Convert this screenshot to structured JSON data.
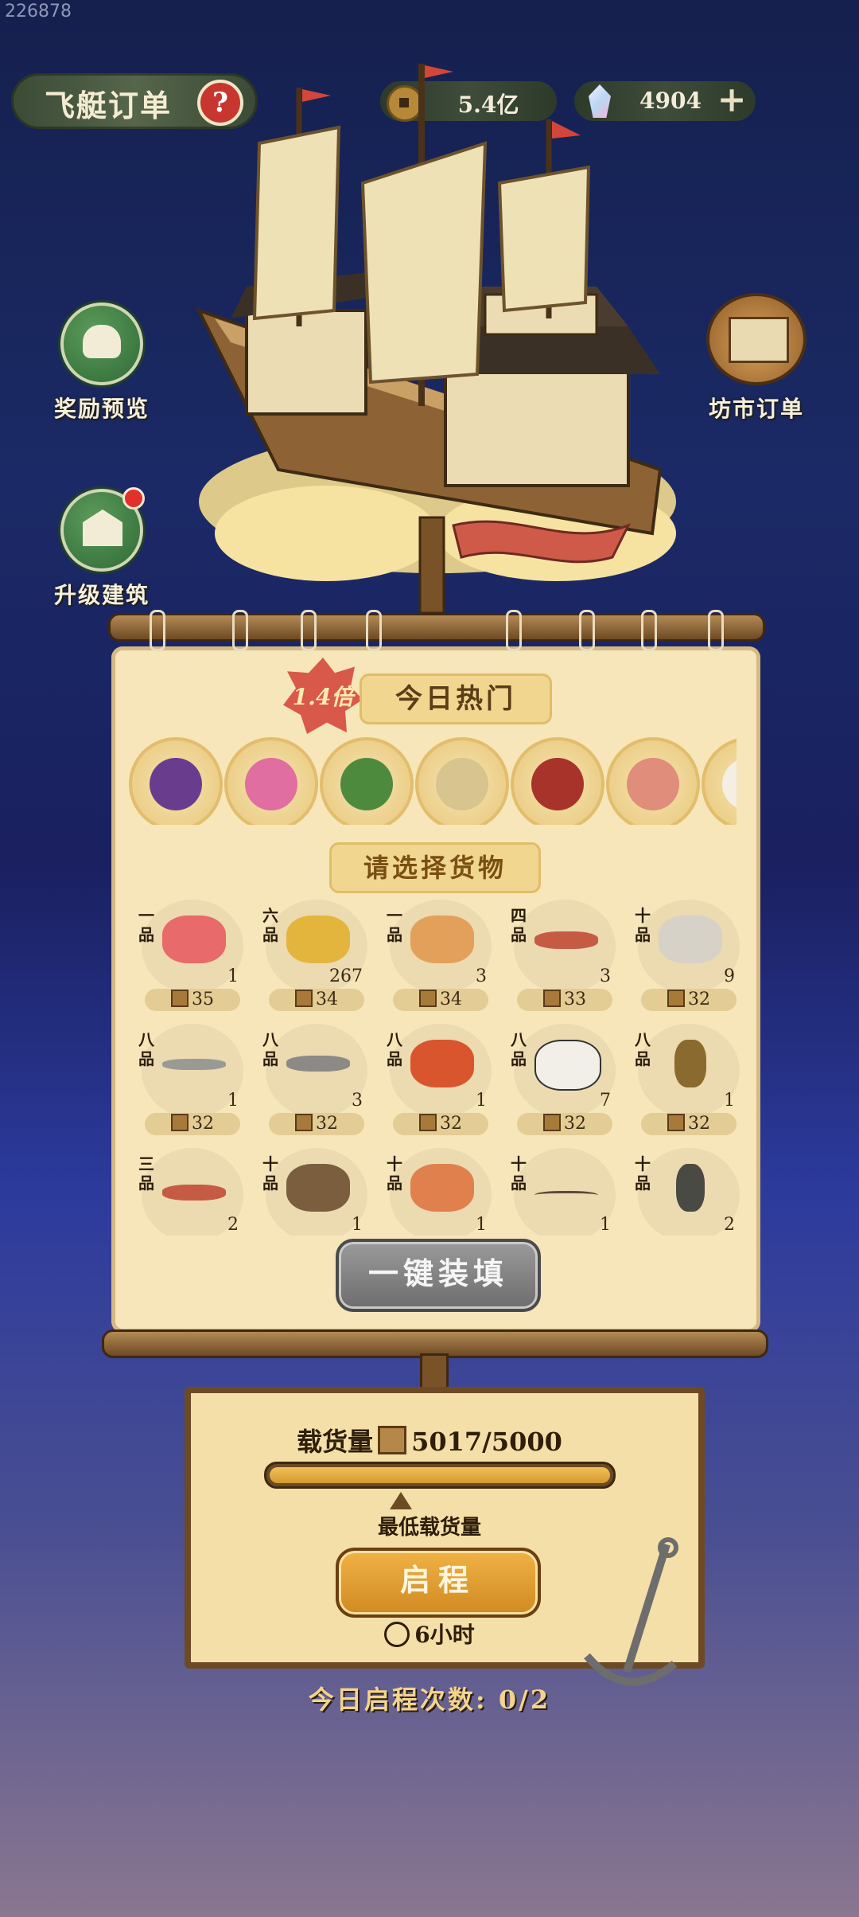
{
  "id_tag": "226878",
  "header": {
    "title": "飞艇订单",
    "help_glyph": "?"
  },
  "resources": {
    "coins": "5.4亿",
    "gems": "4904",
    "plus": "+"
  },
  "side": {
    "rewards_label": "奖励预览",
    "upgrade_label": "升级建筑",
    "market_label": "坊市订单"
  },
  "hot": {
    "multiplier": "1.4倍",
    "title": "今日热门",
    "items": [
      "eggplant-icon",
      "flower-icon",
      "watermelon-icon",
      "zongzi-icon",
      "spicy-dish-icon",
      "salmon-icon",
      "egg-icon"
    ]
  },
  "goods": {
    "title": "请选择货物",
    "items": [
      {
        "grade": "一品",
        "qty": "1",
        "price": "35",
        "icon": "goldfish-icon"
      },
      {
        "grade": "六品",
        "qty": "267",
        "price": "34",
        "icon": "pineapple-icon"
      },
      {
        "grade": "一品",
        "qty": "3",
        "price": "34",
        "icon": "dragon-icon"
      },
      {
        "grade": "四品",
        "qty": "3",
        "price": "33",
        "icon": "fish-icon"
      },
      {
        "grade": "十品",
        "qty": "9",
        "price": "32",
        "icon": "ray-icon"
      },
      {
        "grade": "八品",
        "qty": "1",
        "price": "32",
        "icon": "eel-icon"
      },
      {
        "grade": "八品",
        "qty": "3",
        "price": "32",
        "icon": "catfish-icon"
      },
      {
        "grade": "八品",
        "qty": "1",
        "price": "32",
        "icon": "butterfly-icon"
      },
      {
        "grade": "八品",
        "qty": "7",
        "price": "32",
        "icon": "moth-icon"
      },
      {
        "grade": "八品",
        "qty": "1",
        "price": "32",
        "icon": "beetle-icon"
      },
      {
        "grade": "三品",
        "qty": "2",
        "price": "",
        "icon": "fish-icon"
      },
      {
        "grade": "十品",
        "qty": "1",
        "price": "",
        "icon": "moth-icon"
      },
      {
        "grade": "十品",
        "qty": "1",
        "price": "",
        "icon": "butterfly-icon"
      },
      {
        "grade": "十品",
        "qty": "1",
        "price": "",
        "icon": "water-strider-icon"
      },
      {
        "grade": "十品",
        "qty": "2",
        "price": "",
        "icon": "bug-icon"
      }
    ],
    "fill_button": "一键装填"
  },
  "cargo": {
    "label": "载货量",
    "value": "5017/5000",
    "progress": 1.0,
    "min_label": "最低载货量",
    "start_button": "启程",
    "duration": "6小时",
    "trips": "今日启程次数: 0/2"
  },
  "colors": {
    "accent_green": "#2f6a36",
    "cloth": "#f6e6b9",
    "button_gold": "#d08a22",
    "alert_red": "#e0312b"
  }
}
